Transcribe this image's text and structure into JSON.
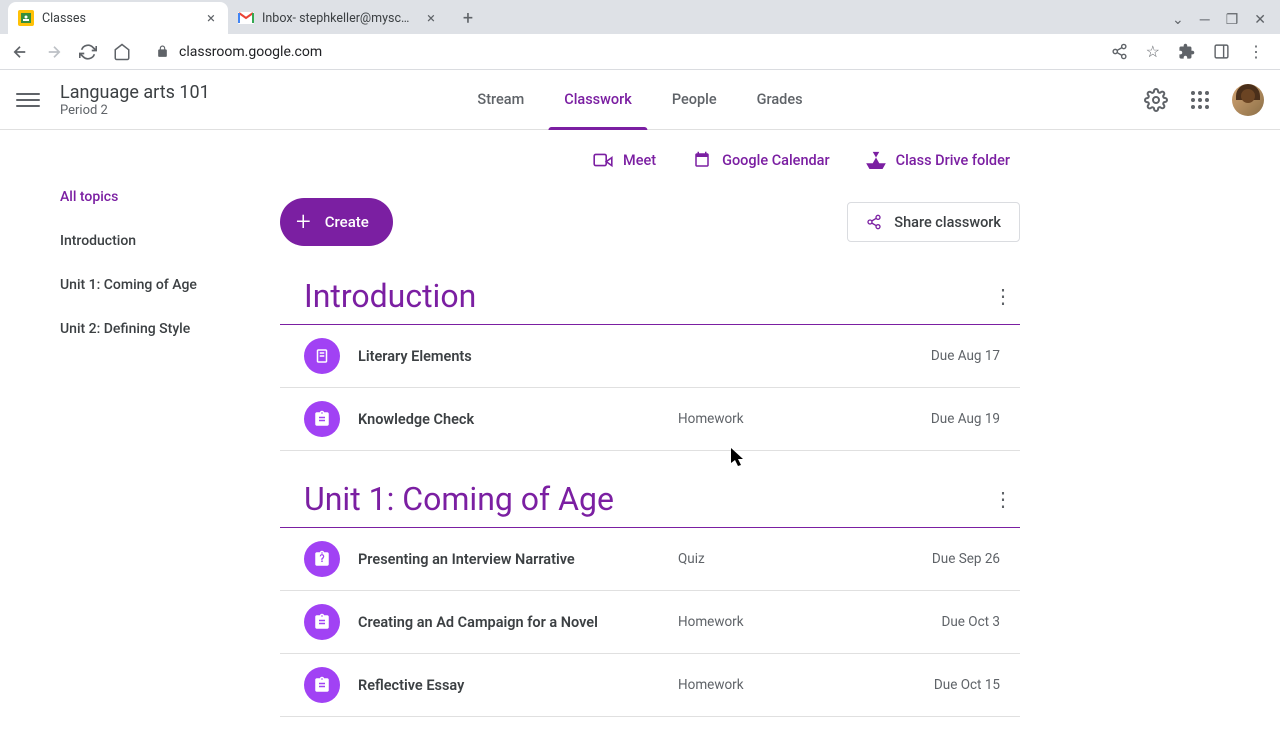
{
  "browser": {
    "tabs": [
      {
        "title": "Classes",
        "favicon": "classroom"
      },
      {
        "title": "Inbox- stephkeller@myschool.edu",
        "favicon": "gmail"
      }
    ],
    "url": "classroom.google.com"
  },
  "header": {
    "class_name": "Language arts 101",
    "class_period": "Period 2",
    "nav": [
      "Stream",
      "Classwork",
      "People",
      "Grades"
    ],
    "active_nav": "Classwork"
  },
  "quick_links": {
    "meet": "Meet",
    "calendar": "Google Calendar",
    "drive": "Class Drive folder"
  },
  "actions": {
    "create": "Create",
    "share": "Share classwork"
  },
  "sidebar": {
    "items": [
      "All topics",
      "Introduction",
      "Unit 1: Coming of Age",
      "Unit 2: Defining Style"
    ],
    "active": "All topics"
  },
  "topics": [
    {
      "title": "Introduction",
      "assignments": [
        {
          "icon": "material",
          "title": "Literary Elements",
          "type": "",
          "due": "Due Aug 17"
        },
        {
          "icon": "assignment",
          "title": "Knowledge Check",
          "type": "Homework",
          "due": "Due Aug 19"
        }
      ]
    },
    {
      "title": "Unit 1: Coming of Age",
      "assignments": [
        {
          "icon": "quiz",
          "title": "Presenting an Interview Narrative",
          "type": "Quiz",
          "due": "Due Sep 26"
        },
        {
          "icon": "assignment",
          "title": "Creating an Ad Campaign for a Novel",
          "type": "Homework",
          "due": "Due Oct 3"
        },
        {
          "icon": "assignment",
          "title": "Reflective Essay",
          "type": "Homework",
          "due": "Due Oct 15"
        }
      ]
    }
  ]
}
